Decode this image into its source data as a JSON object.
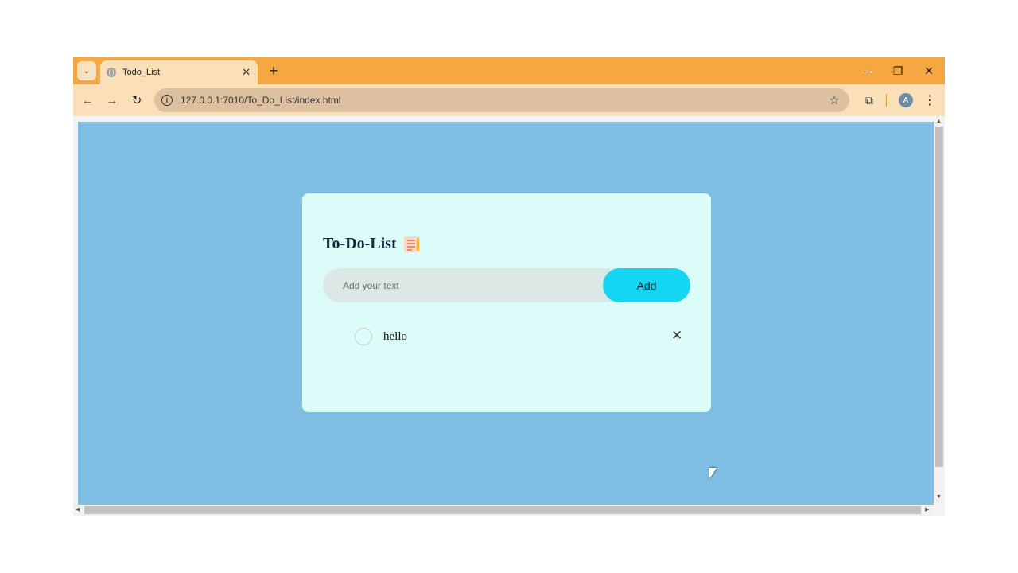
{
  "browser": {
    "tab": {
      "title": "Todo_List",
      "close": "✕"
    },
    "new_tab": "+",
    "tab_search": "⌄",
    "window_controls": {
      "minimize": "–",
      "restore": "❐",
      "close": "✕"
    },
    "nav": {
      "back": "←",
      "forward": "→",
      "reload": "↻"
    },
    "url": "127.0.0.1:7010/To_Do_List/index.html",
    "bookmark": "☆",
    "extensions": "⧉",
    "profile_initial": "A",
    "menu": "⋮",
    "page_bg_color": "#7fbde2",
    "chrome_color": "#f5a742"
  },
  "app": {
    "title": "To-Do-List",
    "input_placeholder": "Add your text",
    "input_value": "",
    "add_label": "Add",
    "accent_color": "#14d6f2",
    "card_color": "#dcfcf9",
    "items": [
      {
        "text": "hello",
        "done": false,
        "delete": "✕"
      }
    ]
  }
}
